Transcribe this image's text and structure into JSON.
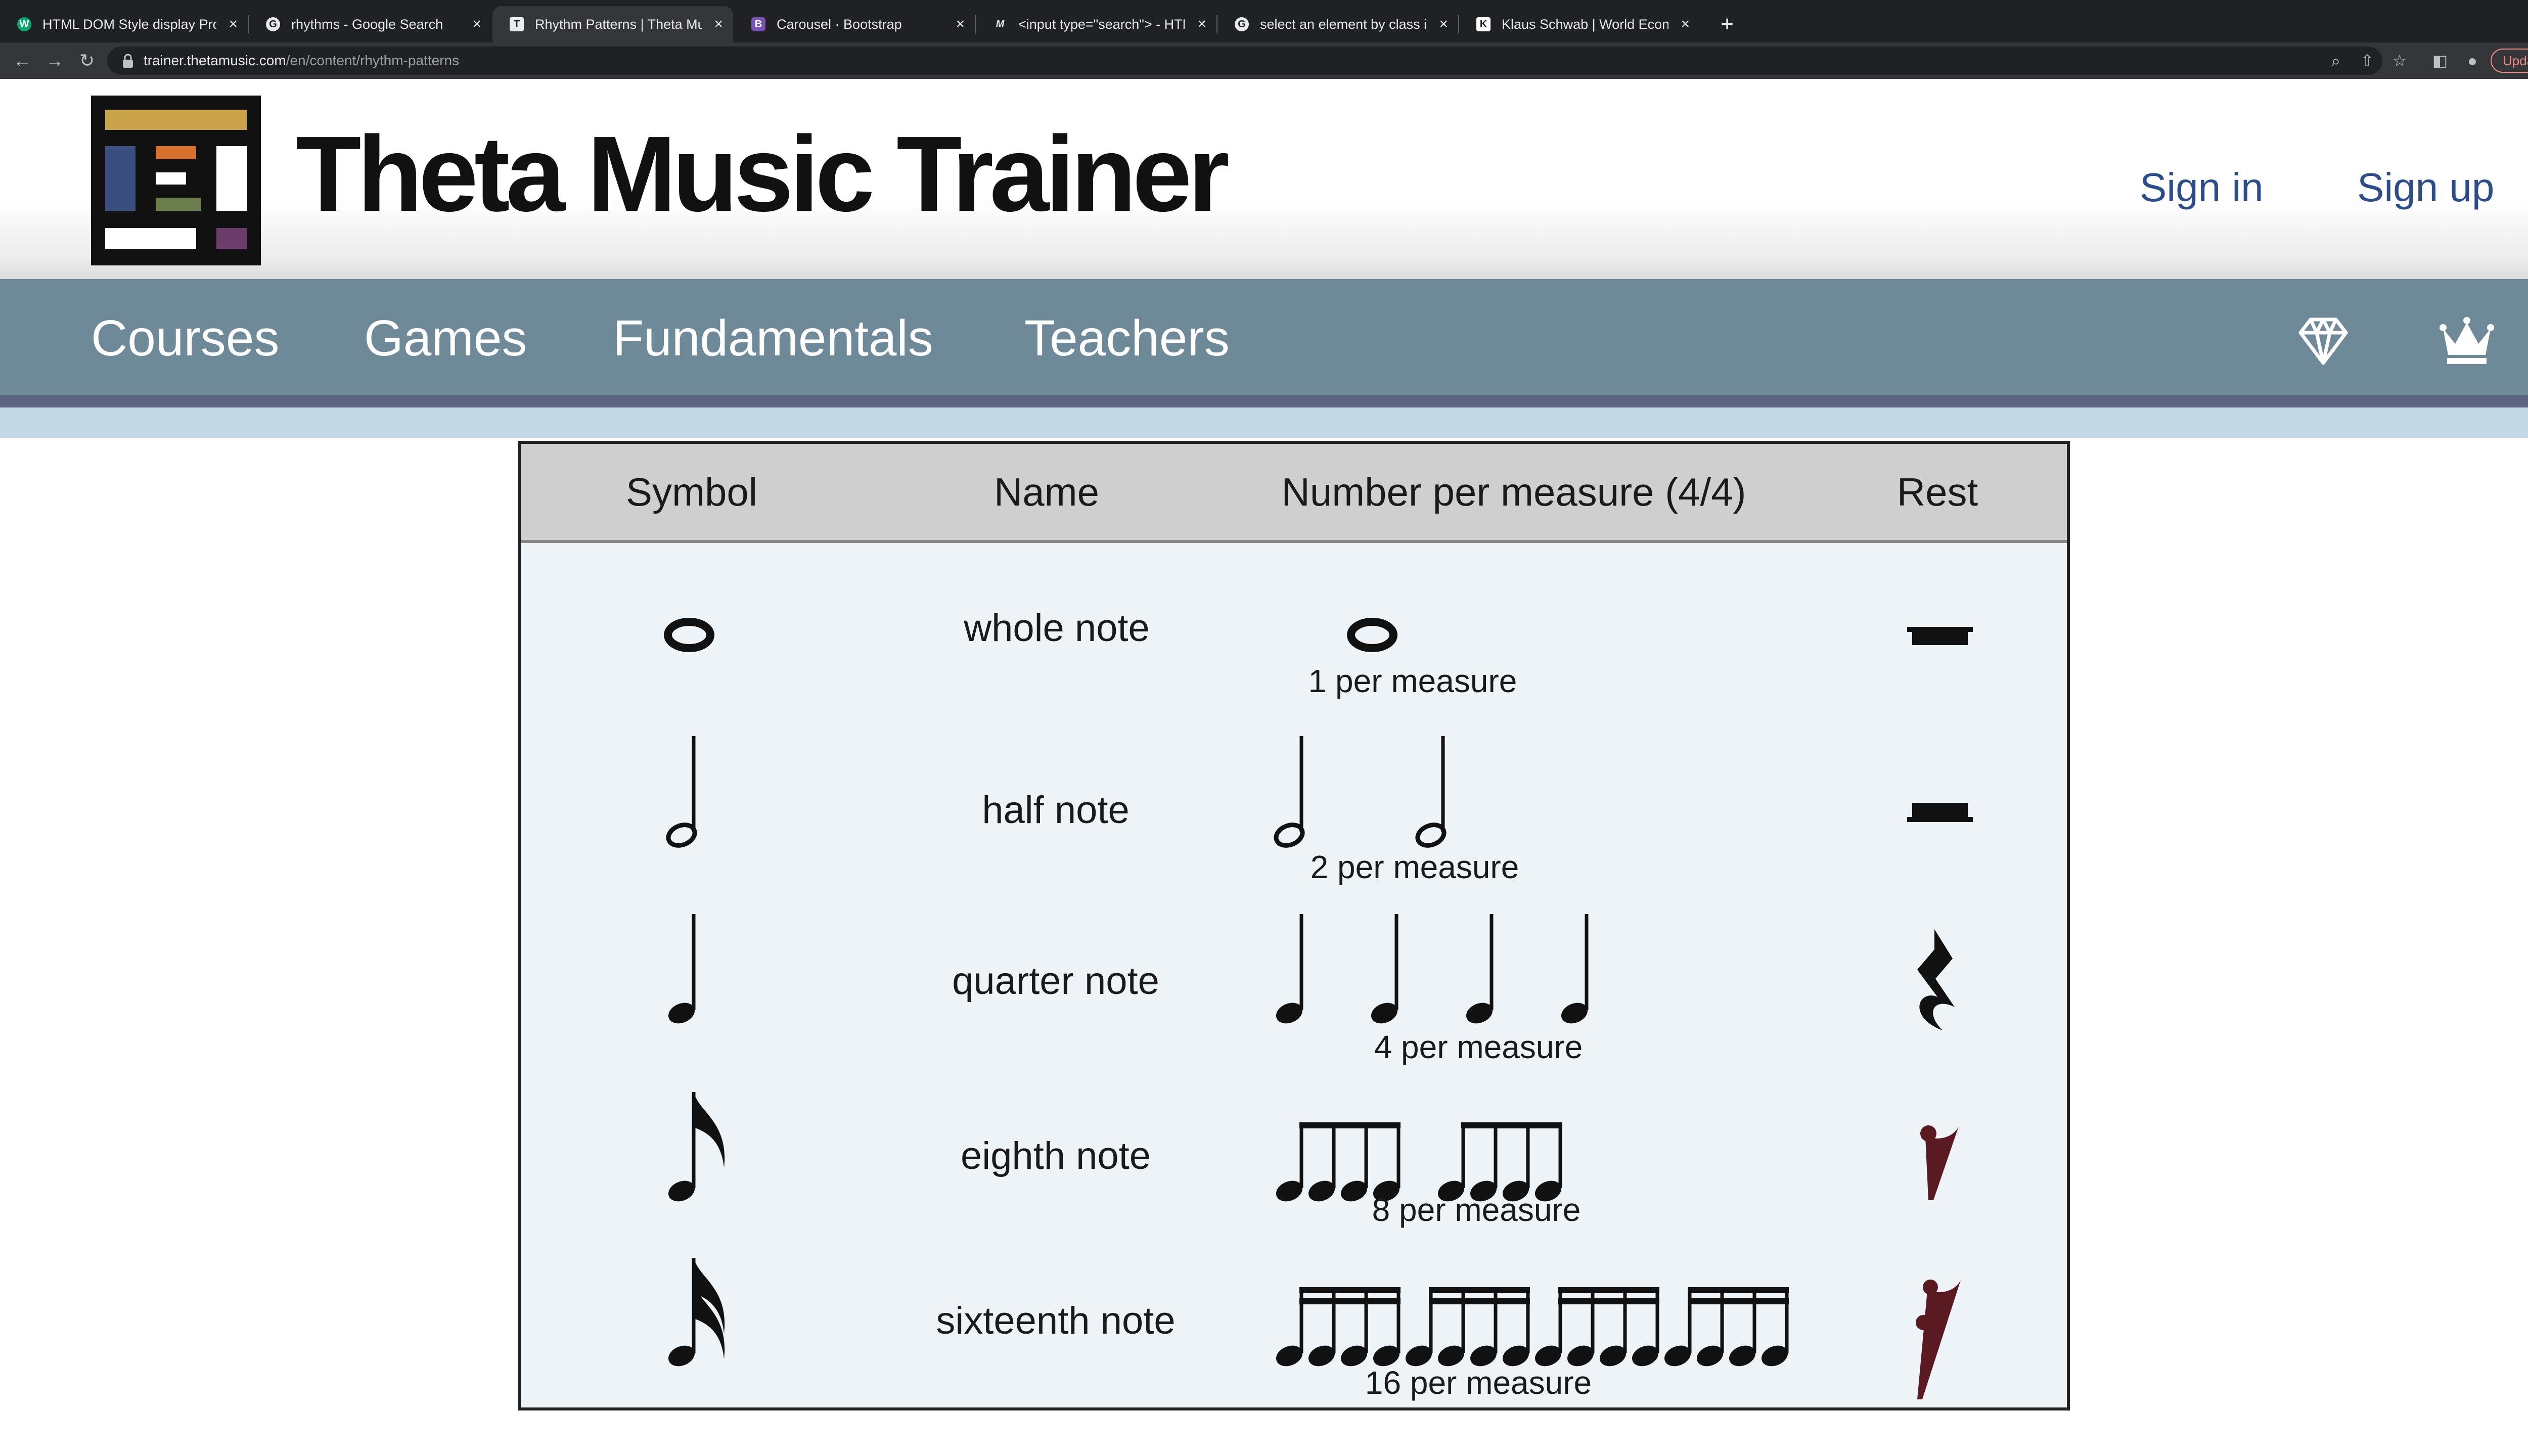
{
  "browser": {
    "tabs": [
      {
        "favicon": "W",
        "title": "HTML DOM Style display Prop",
        "active": false
      },
      {
        "favicon": "G",
        "title": "rhythms - Google Search",
        "active": false
      },
      {
        "favicon": "T",
        "title": "Rhythm Patterns | Theta Music",
        "active": true
      },
      {
        "favicon": "B",
        "title": "Carousel · Bootstrap",
        "active": false
      },
      {
        "favicon": "M",
        "title": "<input type=\"search\"> - HTML",
        "active": false
      },
      {
        "favicon": "G",
        "title": "select an element by class in j",
        "active": false
      },
      {
        "favicon": "K",
        "title": "Klaus Schwab | World Econom",
        "active": false
      }
    ],
    "url_host": "trainer.thetamusic.com",
    "url_path": "/en/content/rhythm-patterns",
    "update_label": "Update"
  },
  "site": {
    "title": "Theta Music Trainer",
    "sign_in": "Sign in",
    "sign_up": "Sign up",
    "nav": [
      "Courses",
      "Games",
      "Fundamentals",
      "Teachers"
    ],
    "logo_colors": [
      "#c9a24a",
      "#3a4f80",
      "#d7722e",
      "#6b7d4a",
      "#6a3d6a"
    ]
  },
  "rhythm_table": {
    "headers": [
      "Symbol",
      "Name",
      "Number per measure (4/4)",
      "Rest"
    ],
    "rows": [
      {
        "name": "whole note",
        "per_measure": "1 per measure"
      },
      {
        "name": "half note",
        "per_measure": "2 per measure"
      },
      {
        "name": "quarter note",
        "per_measure": "4 per measure"
      },
      {
        "name": "eighth note",
        "per_measure": "8 per measure"
      },
      {
        "name": "sixteenth note",
        "per_measure": "16 per measure"
      }
    ]
  }
}
